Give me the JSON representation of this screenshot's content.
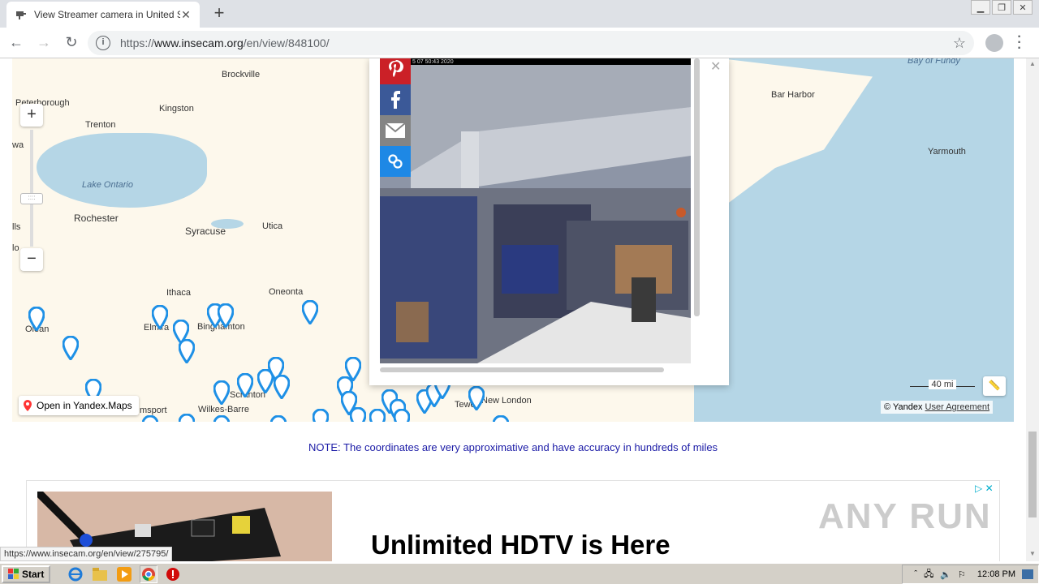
{
  "browser": {
    "tab_title": "View Streamer camera in United Stat",
    "url_prefix": "https://",
    "url_host": "www.insecam.org",
    "url_path": "/en/view/848100/",
    "new_tab": "+",
    "tab_close": "✕"
  },
  "map": {
    "labels": [
      "Brockville",
      "Peterborough",
      "Kingston",
      "Trenton",
      "wa",
      "Lake Ontario",
      "Rochester",
      "Syracuse",
      "Utica",
      "lls",
      "lo",
      "Ithaca",
      "Oneonta",
      "Olean",
      "Elmira",
      "Binghamton",
      "Scranton",
      "Wilkes-Barre",
      "msport",
      "Bay of Fundy",
      "Bar Harbor",
      "Yarmouth",
      "ne",
      "Tewen",
      "New London"
    ],
    "open_in": "Open in Yandex.Maps",
    "scale": "40 mi",
    "copyright": "© Yandex",
    "agreement": "User Agreement",
    "zoom_in": "+",
    "zoom_out": "−",
    "slider_grip": "::::"
  },
  "popup": {
    "timestamp": "5 07 50:43 2020",
    "close": "✕"
  },
  "note": "NOTE: The coordinates are very approximative and have accuracy in hundreds of miles",
  "ad": {
    "headline": "Unlimited HDTV is Here"
  },
  "watermark": "ANY RUN",
  "status_url": "https://www.insecam.org/en/view/275795/",
  "taskbar": {
    "start": "Start",
    "clock": "12:08 PM"
  }
}
